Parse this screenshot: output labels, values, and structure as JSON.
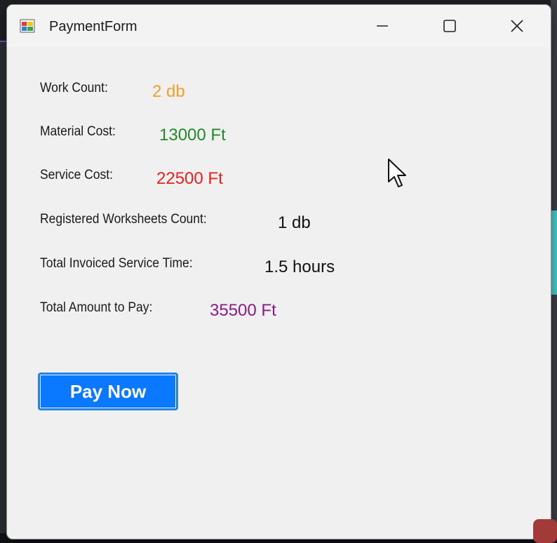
{
  "window": {
    "title": "PaymentForm"
  },
  "summary": [
    {
      "label": "Work Count:",
      "value": "2 db",
      "color": "#f0a028"
    },
    {
      "label": "Material Cost:",
      "value": "13000 Ft",
      "color": "#1f8a2a"
    },
    {
      "label": "Service Cost:",
      "value": "22500 Ft",
      "color": "#e82020"
    },
    {
      "label": "Registered Worksheets Count:",
      "value": "1 db",
      "color": "#111111"
    },
    {
      "label": "Total Invoiced Service Time:",
      "value": "1.5 hours",
      "color": "#111111"
    },
    {
      "label": "Total Amount to Pay:",
      "value": "35500 Ft",
      "color": "#8a1a8a"
    }
  ],
  "actions": {
    "pay_label": "Pay Now"
  },
  "icons": {
    "app": "winforms-app-icon",
    "minimize": "minimize-icon",
    "maximize": "maximize-icon",
    "close": "close-icon",
    "cursor": "mouse-pointer-icon"
  }
}
